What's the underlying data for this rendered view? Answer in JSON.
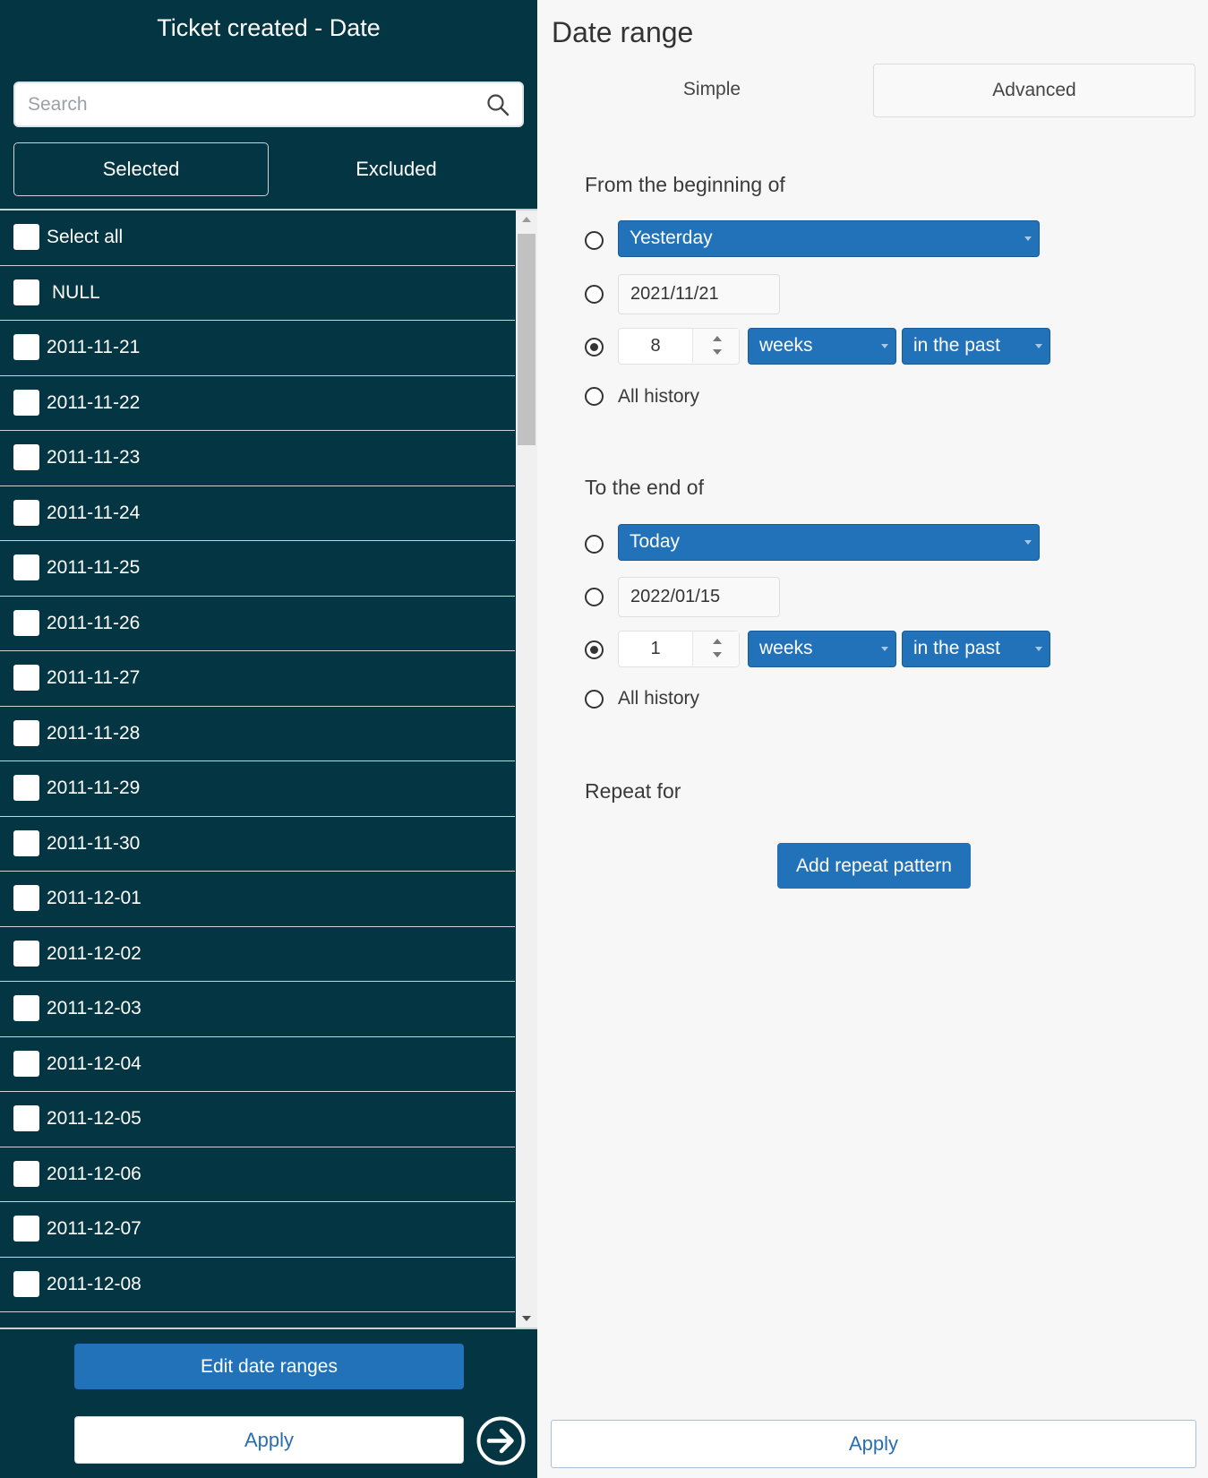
{
  "filter_panel": {
    "title": "Ticket created - Date",
    "search": {
      "placeholder": "Search",
      "value": ""
    },
    "mode_tabs": {
      "selected_label": "Selected",
      "excluded_label": "Excluded",
      "active": "Selected"
    },
    "items": [
      {
        "label": "Select all",
        "checked": false
      },
      {
        "label": "NULL",
        "checked": false
      },
      {
        "label": "2011-11-21",
        "checked": false
      },
      {
        "label": "2011-11-22",
        "checked": false
      },
      {
        "label": "2011-11-23",
        "checked": false
      },
      {
        "label": "2011-11-24",
        "checked": false
      },
      {
        "label": "2011-11-25",
        "checked": false
      },
      {
        "label": "2011-11-26",
        "checked": false
      },
      {
        "label": "2011-11-27",
        "checked": false
      },
      {
        "label": "2011-11-28",
        "checked": false
      },
      {
        "label": "2011-11-29",
        "checked": false
      },
      {
        "label": "2011-11-30",
        "checked": false
      },
      {
        "label": "2011-12-01",
        "checked": false
      },
      {
        "label": "2011-12-02",
        "checked": false
      },
      {
        "label": "2011-12-03",
        "checked": false
      },
      {
        "label": "2011-12-04",
        "checked": false
      },
      {
        "label": "2011-12-05",
        "checked": false
      },
      {
        "label": "2011-12-06",
        "checked": false
      },
      {
        "label": "2011-12-07",
        "checked": false
      },
      {
        "label": "2011-12-08",
        "checked": false
      }
    ],
    "edit_ranges_label": "Edit date ranges",
    "apply_label": "Apply",
    "go_icon": "arrow-right-circle-icon"
  },
  "date_range": {
    "title": "Date range",
    "tabs": {
      "simple": "Simple",
      "advanced": "Advanced",
      "active": "Simple"
    },
    "from": {
      "label": "From the beginning of",
      "relative_option": "Yesterday",
      "date_value": "2021/11/21",
      "count_value": "8",
      "unit": "weeks",
      "direction": "in the past",
      "all_history_label": "All history",
      "checked_option": "count"
    },
    "to": {
      "label": "To the end of",
      "relative_option": "Today",
      "date_value": "2022/01/15",
      "count_value": "1",
      "unit": "weeks",
      "direction": "in the past",
      "all_history_label": "All history",
      "checked_option": "count"
    },
    "repeat": {
      "label": "Repeat for",
      "button_label": "Add repeat pattern"
    },
    "apply_label": "Apply"
  },
  "colors": {
    "panel_bg": "#033542",
    "accent_blue": "#2272b9",
    "right_bg": "#f7f7f7"
  }
}
